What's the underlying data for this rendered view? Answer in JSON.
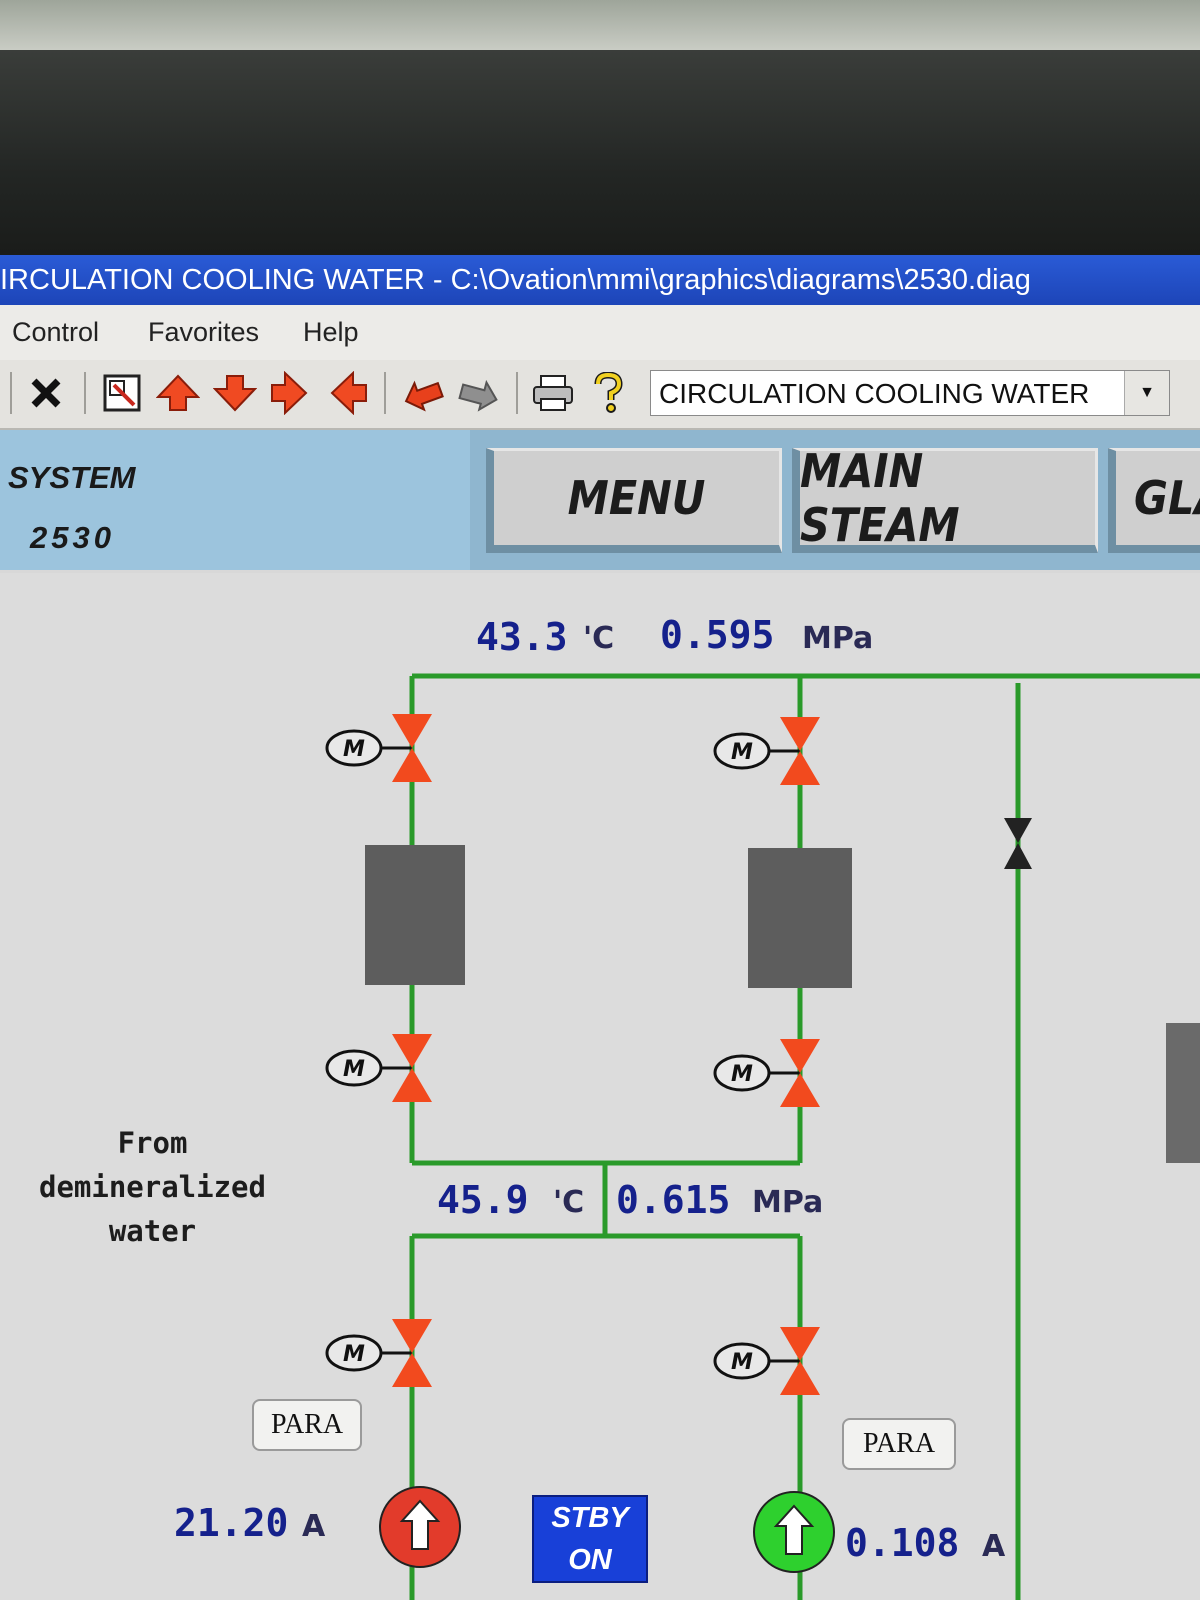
{
  "window": {
    "title": "IRCULATION COOLING WATER - C:\\Ovation\\mmi\\graphics\\diagrams\\2530.diag"
  },
  "menu": {
    "items": [
      "Control",
      "Favorites",
      "Help"
    ]
  },
  "toolbar": {
    "diagram_select": {
      "value": "CIRCULATION COOLING WATER"
    },
    "icons": [
      "close-icon",
      "zoom-window-icon",
      "arrow-up-icon",
      "arrow-down-icon",
      "arrow-right-icon",
      "arrow-left-icon",
      "back-icon",
      "forward-icon",
      "print-icon",
      "help-icon"
    ]
  },
  "header": {
    "system_label": "SYSTEM",
    "diagram_number": "2530",
    "nav_buttons": [
      "MENU",
      "MAIN STEAM",
      "GLA"
    ]
  },
  "diagram": {
    "top_header": {
      "temperature": "43.3",
      "temperature_unit": "'C",
      "pressure": "0.595",
      "pressure_unit": "MPa"
    },
    "mid_header": {
      "temperature": "45.9",
      "temperature_unit": "'C",
      "pressure": "0.615",
      "pressure_unit": "MPa"
    },
    "source_label": "From demineralized\nwater",
    "left_pump": {
      "current": "21.20",
      "unit": "A",
      "para_label": "PARA",
      "status_color": "#e23b2b"
    },
    "right_pump": {
      "current": "0.108",
      "unit": "A",
      "para_label": "PARA",
      "status_color": "#2ed02e"
    },
    "standby": {
      "line1": "STBY",
      "line2": "ON"
    },
    "valve_motor_label": "M",
    "colors": {
      "pipe": "#2a9a2a",
      "valve": "#f24a1e",
      "cooler": "#5d5d5d"
    }
  }
}
